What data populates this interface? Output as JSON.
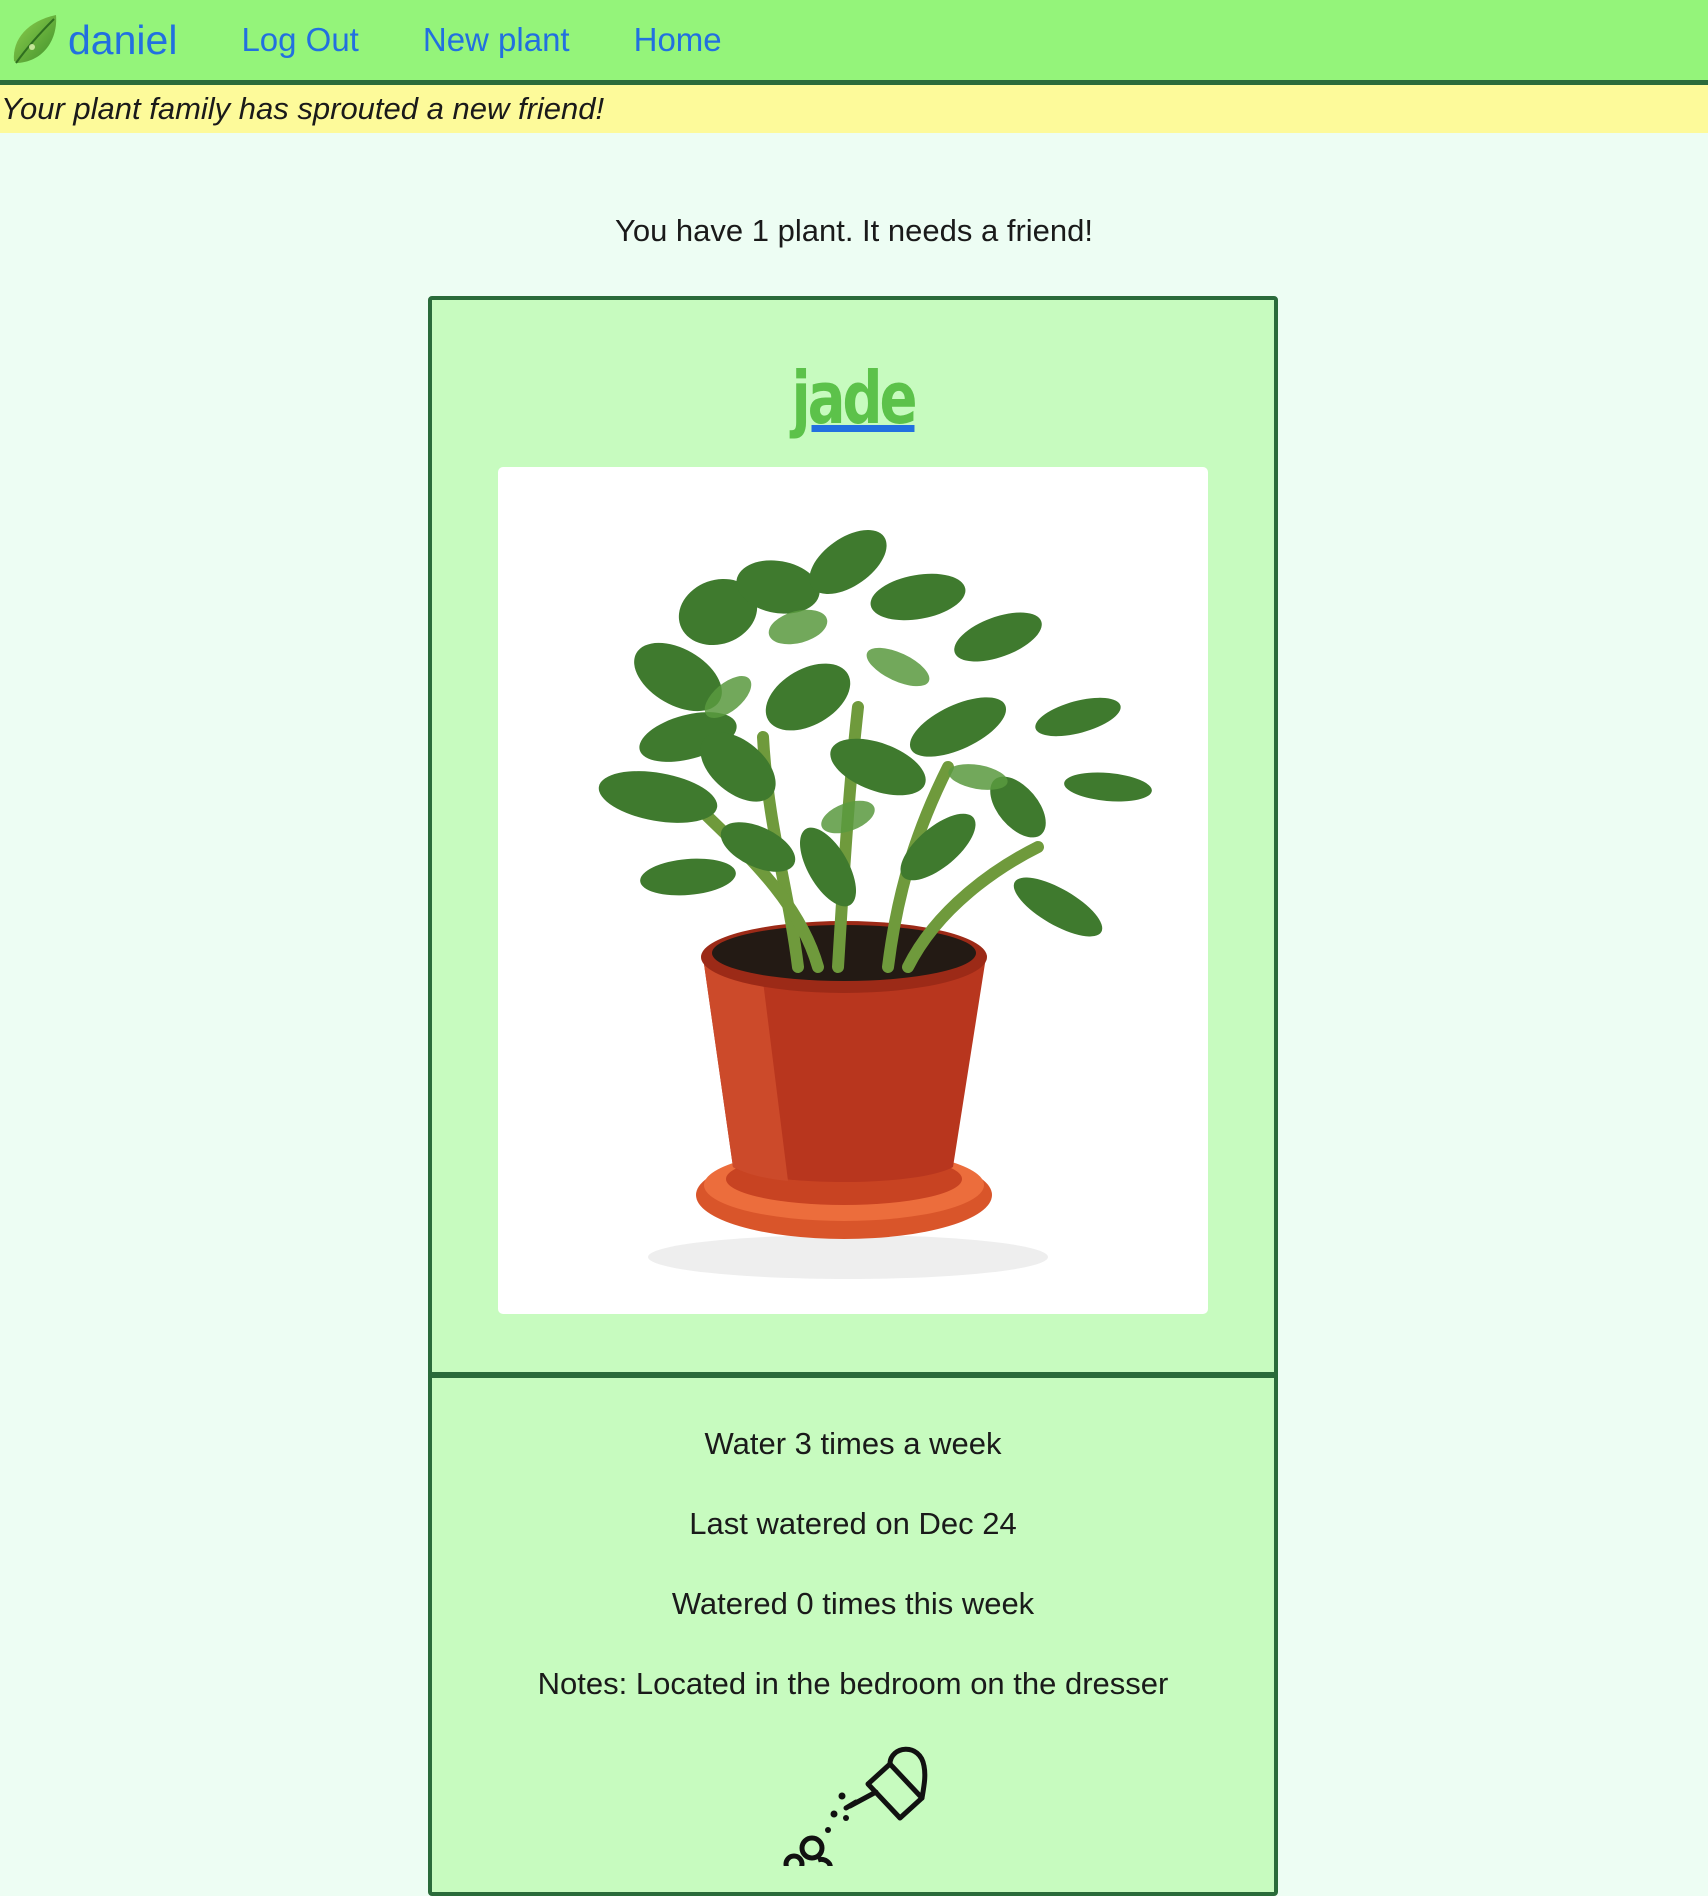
{
  "nav": {
    "username": "daniel",
    "logo_icon": "leaf-icon",
    "links": [
      {
        "label": "Log Out"
      },
      {
        "label": "New plant"
      },
      {
        "label": "Home"
      }
    ]
  },
  "flash": {
    "message": "Your plant family has sprouted a new friend!"
  },
  "summary": {
    "text": "You have 1 plant. It needs a friend!"
  },
  "plant": {
    "name": "jade",
    "image_icon": "jade-plant-photo",
    "water_schedule": "Water 3 times a week",
    "last_watered": "Last watered on Dec 24",
    "watered_this_week": "Watered 0 times this week",
    "notes": "Notes: Located in the bedroom on the dresser",
    "water_icon": "watering-can-icon"
  },
  "colors": {
    "navbar_bg": "#94f47a",
    "link": "#2270e0",
    "flash_bg": "#fdfa9a",
    "page_bg": "#edfdf3",
    "card_bg": "#c7fbbf",
    "card_border": "#2a6b3a",
    "plant_name": "#5cc24a"
  }
}
